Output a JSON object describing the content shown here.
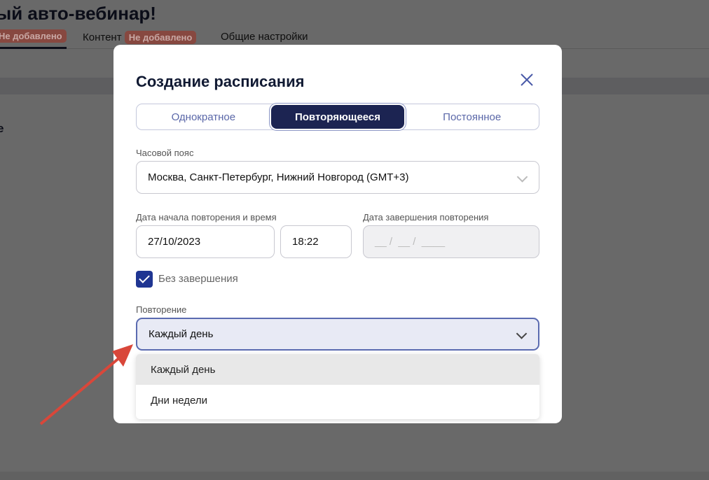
{
  "background": {
    "title": "ый авто-вебинар!",
    "tabs": [
      {
        "badge": "Не добавлено"
      },
      {
        "label": "Контент",
        "badge": "Не добавлено"
      },
      {
        "label": "Общие настройки"
      }
    ],
    "partial_text": "е"
  },
  "modal": {
    "title": "Создание расписания",
    "close_icon": "close-icon",
    "segments": [
      "Однократное",
      "Повторяющееся",
      "Постоянное"
    ],
    "active_segment": "Повторяющееся",
    "timezone": {
      "label": "Часовой пояс",
      "value": "Москва, Санкт-Петербург, Нижний Новгород (GMT+3)"
    },
    "start": {
      "label": "Дата начала повторения и время",
      "date": "27/10/2023",
      "time": "18:22"
    },
    "end": {
      "label": "Дата завершения повторения",
      "placeholder": "__ /  __ /  ____"
    },
    "no_end": {
      "label": "Без завершения",
      "checked": true
    },
    "repeat": {
      "label": "Повторение",
      "value": "Каждый день",
      "options": [
        "Каждый день",
        "Дни недели"
      ]
    }
  },
  "colors": {
    "accent": "#1c2452",
    "arrow": "#d9473a"
  }
}
